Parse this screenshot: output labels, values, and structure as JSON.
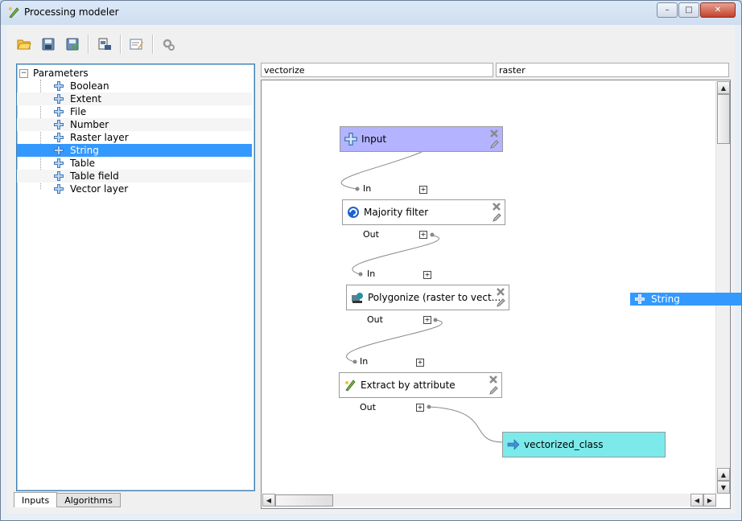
{
  "window": {
    "title": "Processing modeler",
    "controls": [
      "–",
      "□",
      "✕"
    ]
  },
  "toolbar": {
    "icons": [
      "open-icon",
      "save-icon",
      "save-as-icon",
      "export-image-icon",
      "edit-help-icon",
      "run-icon"
    ]
  },
  "tree": {
    "root_label": "Parameters",
    "items": [
      {
        "label": "Boolean"
      },
      {
        "label": "Extent"
      },
      {
        "label": "File"
      },
      {
        "label": "Number"
      },
      {
        "label": "Raster layer"
      },
      {
        "label": "String"
      },
      {
        "label": "Table"
      },
      {
        "label": "Table field"
      },
      {
        "label": "Vector layer"
      }
    ],
    "selected_index": 5
  },
  "tabs": [
    {
      "label": "Inputs"
    },
    {
      "label": "Algorithms"
    }
  ],
  "fields": {
    "name_value": "vectorize",
    "group_value": "raster"
  },
  "model": {
    "input_node": "Input",
    "majority_node": "Majority filter",
    "polygonize_node": "Polygonize (raster to vect...",
    "extract_node": "Extract by attribute",
    "output_node": "vectorized_class",
    "port_in": "In",
    "port_out": "Out"
  },
  "drag": {
    "label": "String"
  },
  "colors": {
    "input_node": "#b3b3ff",
    "output_node": "#7ceaea",
    "selection": "#3399ff"
  }
}
